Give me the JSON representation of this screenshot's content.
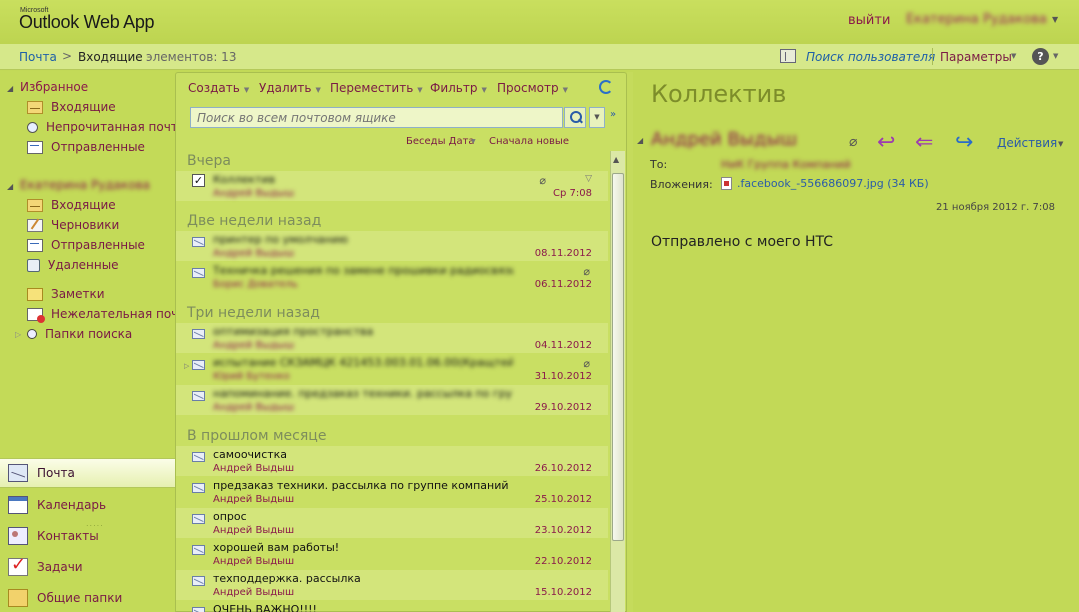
{
  "header": {
    "brand_small": "Microsoft",
    "brand": "Outlook Web App",
    "logout": "выйти",
    "username": "Екатерина Рудакова"
  },
  "nav": {
    "breadcrumb_mail": "Почта",
    "breadcrumb_sep": ">",
    "breadcrumb_folder": "Входящие",
    "item_count": "элементов: 13",
    "find_user": "Поиск пользователя",
    "options": "Параметры",
    "help": "?"
  },
  "sidebar": {
    "favorites_title": "Избранное",
    "favorites": [
      {
        "label": "Входящие",
        "icon": "inbox-icon"
      },
      {
        "label": "Непрочитанная почта",
        "icon": "unread-icon"
      },
      {
        "label": "Отправленные",
        "icon": "sent-icon"
      }
    ],
    "mailbox_title": "Екатерина Рудакова",
    "mailbox": [
      {
        "label": "Входящие",
        "icon": "inbox-icon"
      },
      {
        "label": "Черновики",
        "icon": "drafts-icon"
      },
      {
        "label": "Отправленные",
        "icon": "sent-icon"
      },
      {
        "label": "Удаленные",
        "icon": "deleted-icon"
      },
      {
        "label": "Заметки",
        "icon": "notes-icon"
      },
      {
        "label": "Нежелательная почта",
        "icon": "junk-icon"
      },
      {
        "label": "Папки поиска",
        "icon": "search-folder-icon"
      }
    ],
    "grip": ".....",
    "modules": [
      {
        "label": "Почта",
        "icon": "mail-icon",
        "active": true
      },
      {
        "label": "Календарь",
        "icon": "calendar-icon",
        "active": false
      },
      {
        "label": "Контакты",
        "icon": "contacts-icon",
        "active": false
      },
      {
        "label": "Задачи",
        "icon": "tasks-icon",
        "active": false
      },
      {
        "label": "Общие папки",
        "icon": "public-folders-icon",
        "active": false
      }
    ]
  },
  "list": {
    "toolbar": {
      "create": "Создать",
      "delete": "Удалить",
      "move": "Переместить",
      "filter": "Фильтр",
      "view": "Просмотр"
    },
    "search_placeholder": "Поиск во всем почтовом ящике",
    "sort_conversations": "Беседы Дата",
    "sort_newest": "Сначала новые",
    "groups": [
      {
        "label": "Вчера"
      },
      {
        "label": "Две недели назад"
      },
      {
        "label": "Три недели назад"
      },
      {
        "label": "В прошлом месяце"
      }
    ],
    "messages": [
      {
        "subject": "Коллектив",
        "from": "Андрей Выдыш",
        "date": "Ср 7:08",
        "attachment": true,
        "selected": true,
        "blurred": true
      },
      {
        "subject": "принтер по умолчанию",
        "from": "Андрей Выдыш",
        "date": "08.11.2012",
        "blurred": true
      },
      {
        "subject": "Техничка решения по замене прошивки радиосвязи НЭК ...",
        "from": "Борис Дователь",
        "date": "06.11.2012",
        "attachment": true,
        "blurred": true
      },
      {
        "subject": "оптимизация пространства",
        "from": "Андрей Выдыш",
        "date": "04.11.2012",
        "blurred": true
      },
      {
        "subject": "испытание СКЗАМЦК 421453.003.01.06.00(Кращтейн)",
        "from": "Юрий Бутенко",
        "date": "31.10.2012",
        "attachment": true,
        "blurred": true
      },
      {
        "subject": "напоминание. предзаказ техники. рассылка по группе ...",
        "from": "Андрей Выдыш",
        "date": "29.10.2012",
        "blurred": true
      },
      {
        "subject": "самоочистка",
        "from": "Андрей Выдыш",
        "date": "26.10.2012"
      },
      {
        "subject": "предзаказ техники. рассылка по группе компаний",
        "from": "Андрей Выдыш",
        "date": "25.10.2012"
      },
      {
        "subject": "опрос",
        "from": "Андрей Выдыш",
        "date": "23.10.2012"
      },
      {
        "subject": "хорошей вам работы!",
        "from": "Андрей Выдыш",
        "date": "22.10.2012"
      },
      {
        "subject": "техподдержка. рассылка",
        "from": "Андрей Выдыш",
        "date": "15.10.2012"
      },
      {
        "subject": "ОЧЕНЬ ВАЖНО!!!!",
        "from": "",
        "date": ""
      }
    ]
  },
  "reading": {
    "subject": "Коллектив",
    "sender": "Андрей Выдыш",
    "actions": "Действия",
    "to_label": "То:",
    "to_value": "НиК Группа Компаний",
    "attachments_label": "Вложения:",
    "attachment_name": ".facebook_-556686097.jpg (34 КБ)",
    "datetime": "21 ноября 2012 г. 7:08",
    "body": "Отправлено с моего HTC"
  },
  "colors": {
    "background": "#c2d957",
    "link": "#1e5fa8",
    "accent": "#8b1a4a",
    "group_heading": "#7d8d5c"
  }
}
